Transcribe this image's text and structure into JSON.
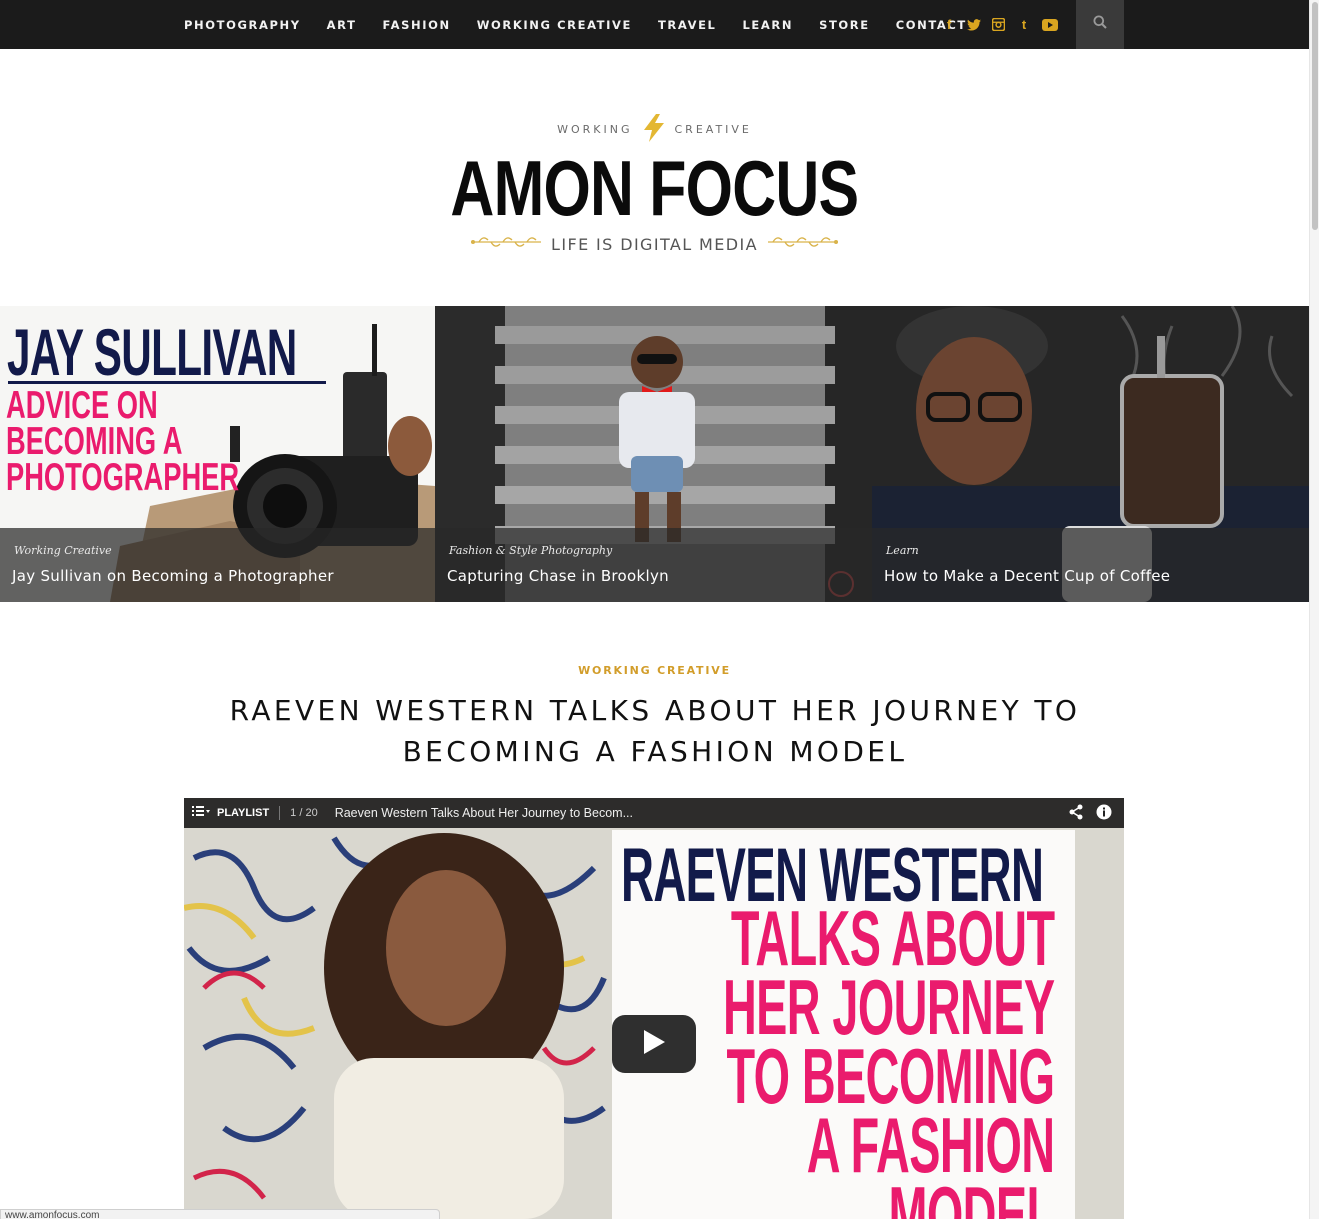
{
  "nav": {
    "items": [
      "PHOTOGRAPHY",
      "ART",
      "FASHION",
      "WORKING CREATIVE",
      "TRAVEL",
      "LEARN",
      "STORE",
      "CONTACT"
    ],
    "social": [
      {
        "icon": "facebook-icon",
        "glyph": "f"
      },
      {
        "icon": "twitter-icon",
        "glyph": ""
      },
      {
        "icon": "instagram-icon",
        "glyph": ""
      },
      {
        "icon": "tumblr-icon",
        "glyph": "t"
      },
      {
        "icon": "youtube-icon",
        "glyph": ""
      }
    ],
    "search_icon": "search-icon",
    "accent": "#d9a520"
  },
  "masthead": {
    "kicker_left": "WORKING",
    "kicker_right": "CREATIVE",
    "logo": "AMON FOCUS",
    "tagline": "LIFE IS DIGITAL MEDIA"
  },
  "featured": [
    {
      "categories": "Working Creative",
      "title": "Jay Sullivan on Becoming a Photographer",
      "art_name": "JAY SULLIVAN",
      "art_sub": "ADVICE ON\nBECOMING A\nPHOTOGRAPHER"
    },
    {
      "categories": "Fashion & Style   Photography",
      "title": "Capturing Chase in Brooklyn"
    },
    {
      "categories": "Learn",
      "title": "How to Make a Decent Cup of Coffee"
    }
  ],
  "article": {
    "category": "WORKING CREATIVE",
    "title": "RAEVEN WESTERN TALKS ABOUT HER JOURNEY TO BECOMING A FASHION MODEL"
  },
  "video": {
    "playlist_label": "PLAYLIST",
    "playlist_count": "1 / 20",
    "title": "Raeven Western Talks About Her Journey to Becom...",
    "art_name": "RAEVEN WESTERN",
    "art_sub": "TALKS ABOUT\nHER JOURNEY\nTO BECOMING\nA FASHION\nMODEL"
  },
  "status_url": "www.amonfocus.com",
  "colors": {
    "nav_bg": "#1b1b1b",
    "gold": "#d29d2a",
    "navy": "#121a4a",
    "pink": "#ea1b6d"
  }
}
